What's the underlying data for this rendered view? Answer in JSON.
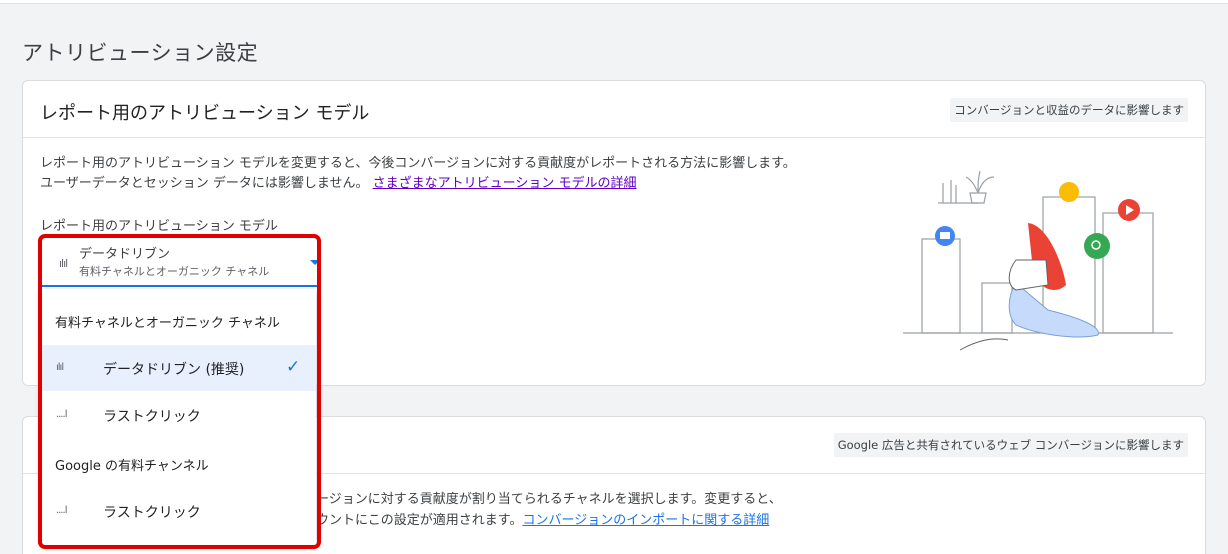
{
  "page": {
    "title": "アトリビューション設定"
  },
  "card1": {
    "title": "レポート用のアトリビューション モデル",
    "chip": "コンバージョンと収益のデータに影響します",
    "desc_line1": "レポート用のアトリビューション モデルを変更すると、今後コンバージョンに対する貢献度がレポートされる方法に影響します。",
    "desc_line2": "ユーザーデータとセッション データには影響しません。",
    "desc_link": "さまざまなアトリビューション モデルの詳細",
    "field_label": "レポート用のアトリビューション モデル",
    "select": {
      "value": "データドリブン",
      "subtext": "有料チャネルとオーガニック チャネル",
      "icon": "bar-chart-icon"
    }
  },
  "card2": {
    "chip": "Google 広告と共有されているウェブ コンバージョンに影響します",
    "desc_line1": "ージョンに対する貢献度が割り当てられるチャネルを選択します。変更すると、",
    "desc_line2": "ウントにこの設定が適用されます。",
    "desc_link": "コンバージョンのインポートに関する詳細"
  },
  "dropdown": {
    "group1": "有料チャネルとオーガニック チャネル",
    "item_datadriven": "データドリブン (推奨)",
    "item_lastclick1": "ラストクリック",
    "group2": "Google の有料チャンネル",
    "item_lastclick2": "ラストクリック",
    "check_icon": "check-icon"
  },
  "colors": {
    "accent": "#1a73e8",
    "highlight": "#e00000",
    "link_visited": "#6200c9",
    "selected_bg": "#e8f0fe"
  }
}
